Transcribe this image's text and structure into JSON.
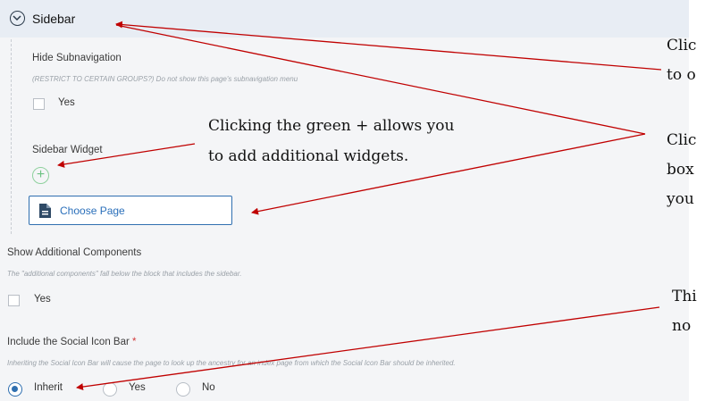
{
  "header": {
    "title": "Sidebar"
  },
  "hide_subnav": {
    "label": "Hide Subnavigation",
    "help": "(RESTRICT TO CERTAIN GROUPS?) Do not show this page's subnavigation menu",
    "option": "Yes"
  },
  "sidebar_widget": {
    "label": "Sidebar Widget",
    "add_symbol": "+",
    "choose_label": "Choose Page"
  },
  "additional": {
    "label": "Show Additional Components",
    "help": "The \"additional components\" fall below the block that includes the sidebar.",
    "option": "Yes"
  },
  "social": {
    "label": "Include the Social Icon Bar",
    "required_mark": "*",
    "help": "Inheriting the Social Icon Bar will cause the page to look up the ancestry for an index page from which the Social Icon Bar should be inherited.",
    "options": [
      "Inherit",
      "Yes",
      "No"
    ],
    "selected": "Inherit"
  },
  "annotations": {
    "note1_line1": "Clic",
    "note1_line2": "to o",
    "note2_line1": "Clicking the green + allows you",
    "note2_line2": "to add additional widgets.",
    "note3_line1": "Clic",
    "note3_line2": "box",
    "note3_line3": "you",
    "note4_line1": "Thi",
    "note4_line2": "no"
  },
  "colors": {
    "accent": "#2f6fb0",
    "add": "#6cc283",
    "arrow": "#c00000",
    "required": "#d23b3b"
  }
}
